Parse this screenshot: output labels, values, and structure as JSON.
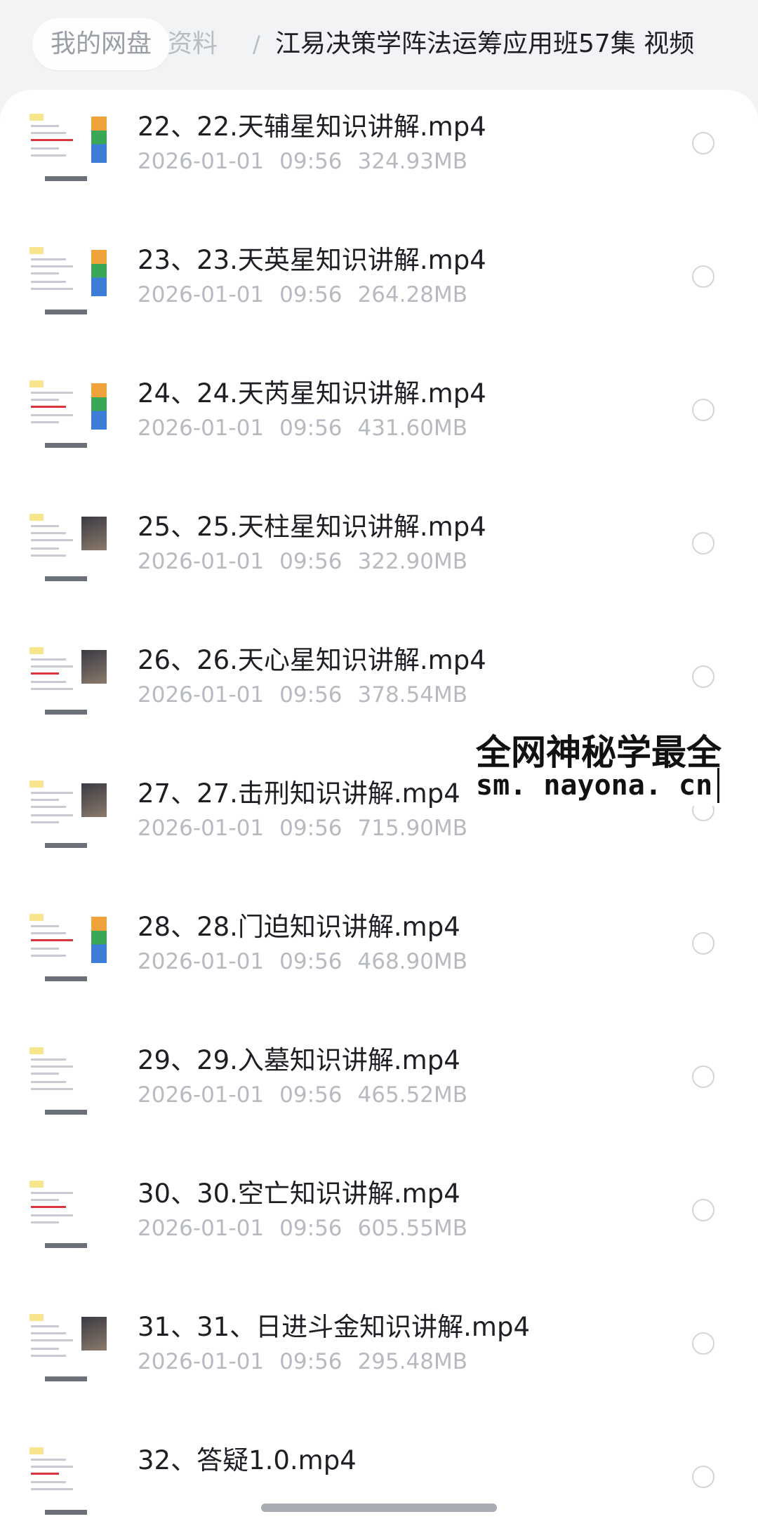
{
  "breadcrumb": {
    "root": "我的网盘",
    "middle": "资料",
    "separator": "/",
    "current": "江易决策学阵法运筹应用班57集 视频"
  },
  "files": [
    {
      "name": "22、22.天辅星知识讲解.mp4",
      "date": "2026-01-01",
      "time": "09:56",
      "size": "324.93MB"
    },
    {
      "name": "23、23.天英星知识讲解.mp4",
      "date": "2026-01-01",
      "time": "09:56",
      "size": "264.28MB"
    },
    {
      "name": "24、24.天芮星知识讲解.mp4",
      "date": "2026-01-01",
      "time": "09:56",
      "size": "431.60MB"
    },
    {
      "name": "25、25.天柱星知识讲解.mp4",
      "date": "2026-01-01",
      "time": "09:56",
      "size": "322.90MB"
    },
    {
      "name": "26、26.天心星知识讲解.mp4",
      "date": "2026-01-01",
      "time": "09:56",
      "size": "378.54MB"
    },
    {
      "name": "27、27.击刑知识讲解.mp4",
      "date": "2026-01-01",
      "time": "09:56",
      "size": "715.90MB"
    },
    {
      "name": "28、28.门迫知识讲解.mp4",
      "date": "2026-01-01",
      "time": "09:56",
      "size": "468.90MB"
    },
    {
      "name": "29、29.入墓知识讲解.mp4",
      "date": "2026-01-01",
      "time": "09:56",
      "size": "465.52MB"
    },
    {
      "name": "30、30.空亡知识讲解.mp4",
      "date": "2026-01-01",
      "time": "09:56",
      "size": "605.55MB"
    },
    {
      "name": "31、31、日进斗金知识讲解.mp4",
      "date": "2026-01-01",
      "time": "09:56",
      "size": "295.48MB"
    },
    {
      "name": "32、答疑1.0.mp4",
      "date": "",
      "time": "",
      "size": ""
    }
  ],
  "watermark": {
    "line1": "全网神秘学最全",
    "line2": "sm. nayona. cn"
  }
}
